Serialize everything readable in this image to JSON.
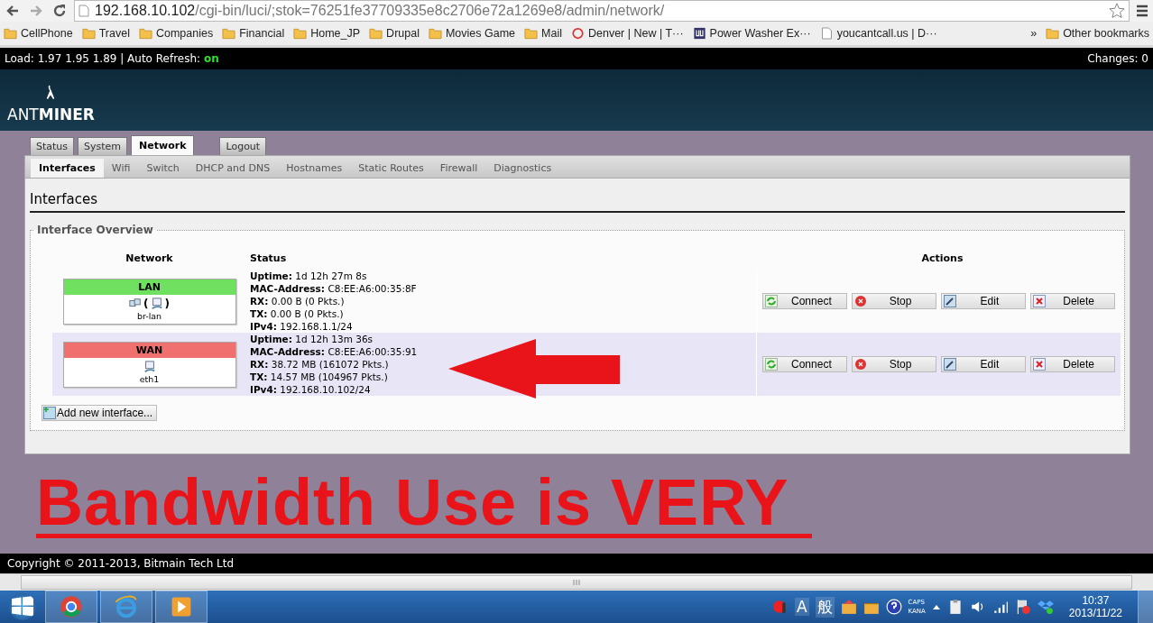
{
  "browser": {
    "url_host": "192.168.10.102",
    "url_path": "/cgi-bin/luci/;stok=76251fe37709335e8c2706e72a1269e8/admin/network/",
    "bookmarks": [
      {
        "label": "CellPhone",
        "kind": "folder"
      },
      {
        "label": "Travel",
        "kind": "folder"
      },
      {
        "label": "Companies",
        "kind": "folder"
      },
      {
        "label": "Financial",
        "kind": "folder"
      },
      {
        "label": "Home_JP",
        "kind": "folder"
      },
      {
        "label": "Drupal",
        "kind": "folder"
      },
      {
        "label": "Movies Game",
        "kind": "folder"
      },
      {
        "label": "Mail",
        "kind": "folder"
      },
      {
        "label": "Denver | New | T···",
        "kind": "circle"
      },
      {
        "label": "Power Washer Ex···",
        "kind": "logo"
      },
      {
        "label": "youcantcall.us | D···",
        "kind": "page"
      }
    ],
    "overflow": "»",
    "other_bookmarks": "Other bookmarks"
  },
  "topbar": {
    "load": "Load: 1.97 1.95 1.89 | Auto Refresh:",
    "auto_refresh": "on",
    "changes": "Changes: 0"
  },
  "logo": "ANT**MINER**",
  "main_tabs": [
    {
      "label": "Status",
      "selected": false
    },
    {
      "label": "System",
      "selected": false
    },
    {
      "label": "Network",
      "selected": true
    },
    {
      "label": "Logout",
      "selected": false
    }
  ],
  "sub_tabs": [
    {
      "label": "Interfaces",
      "selected": true
    },
    {
      "label": "Wifi",
      "selected": false
    },
    {
      "label": "Switch",
      "selected": false
    },
    {
      "label": "DHCP and DNS",
      "selected": false
    },
    {
      "label": "Hostnames",
      "selected": false
    },
    {
      "label": "Static Routes",
      "selected": false
    },
    {
      "label": "Firewall",
      "selected": false
    },
    {
      "label": "Diagnostics",
      "selected": false
    }
  ],
  "page_title": "Interfaces",
  "legend": "Interface Overview",
  "columns": [
    "Network",
    "Status",
    "Actions"
  ],
  "interfaces": [
    {
      "name": "LAN",
      "color": "#70e060",
      "device": "br-lan",
      "kind": "bridge",
      "highlighted": false,
      "bracket_open": "(",
      "bracket_close": ")",
      "status": [
        {
          "label": "Uptime:",
          "value": "1d 12h 27m 8s"
        },
        {
          "label": "MAC-Address:",
          "value": "C8:EE:A6:00:35:8F"
        },
        {
          "label": "RX:",
          "value": "0.00 B (0 Pkts.)"
        },
        {
          "label": "TX:",
          "value": "0.00 B (0 Pkts.)"
        },
        {
          "label": "IPv4:",
          "value": "192.168.1.1/24"
        }
      ],
      "actions": [
        {
          "label": "Connect",
          "kind": "connect"
        },
        {
          "label": "Stop",
          "kind": "stop"
        },
        {
          "label": "Edit",
          "kind": "edit"
        },
        {
          "label": "Delete",
          "kind": "delete"
        }
      ]
    },
    {
      "name": "WAN",
      "color": "#f07070",
      "device": "eth1",
      "kind": "single",
      "highlighted": true,
      "status": [
        {
          "label": "Uptime:",
          "value": "1d 12h 13m 36s"
        },
        {
          "label": "MAC-Address:",
          "value": "C8:EE:A6:00:35:91"
        },
        {
          "label": "RX:",
          "value": "38.72 MB (161072 Pkts.)"
        },
        {
          "label": "TX:",
          "value": "14.57 MB (104967 Pkts.)"
        },
        {
          "label": "IPv4:",
          "value": "192.168.10.102/24"
        }
      ],
      "actions": [
        {
          "label": "Connect",
          "kind": "connect"
        },
        {
          "label": "Stop",
          "kind": "stop"
        },
        {
          "label": "Edit",
          "kind": "edit"
        },
        {
          "label": "Delete",
          "kind": "delete"
        }
      ]
    }
  ],
  "add_button": "Add new interface...",
  "annotation": "Bandwidth Use is VERY",
  "footer": "Copyright © 2011-2013, Bitmain Tech Ltd",
  "taskbar": {
    "ime_mode": "A",
    "ime_kanji": "般",
    "caps": "CAPS",
    "kana": "KANA",
    "time": "10:37",
    "date": "2013/11/22"
  }
}
